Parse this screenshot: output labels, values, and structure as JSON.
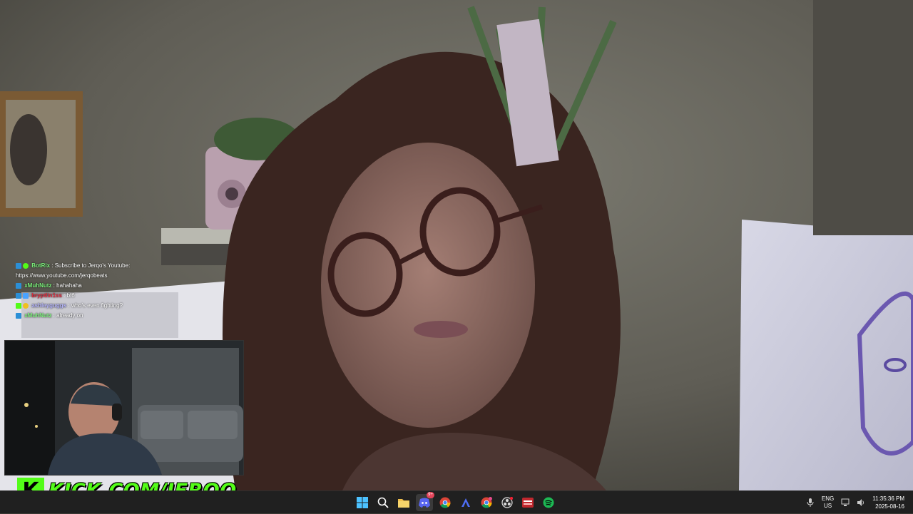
{
  "chat": {
    "messages": [
      {
        "user": "BotRix",
        "text": "Subscribe to Jerqo's Youtube:",
        "cont": "https://www.youtube.com/jerqobeats",
        "color": "#7cf27c"
      },
      {
        "user": "xMuhNutz",
        "text": "hahahaha",
        "color": "#7cf27c"
      },
      {
        "user": "bryptlin1ss",
        "text": "bf6",
        "color": "#e0283a"
      },
      {
        "user": "ashleyguggs",
        "text": "who's even fighting?",
        "color": "#b6b6ff"
      },
      {
        "user": "xMuhNutz",
        "text": "already on",
        "color": "#7cf27c"
      }
    ],
    "separator": " : "
  },
  "overlay": {
    "kick_logo": "K",
    "kick_url": "KICK.COM/JERQO"
  },
  "taskbar": {
    "icons": [
      "windows-start-icon",
      "search-icon",
      "file-explorer-icon",
      "discord-icon",
      "chrome-icon",
      "arc-browser-icon",
      "chrome-alt-icon",
      "obs-icon",
      "video-app-icon",
      "spotify-icon"
    ],
    "discord_badge": "9+",
    "lang_line1": "ENG",
    "lang_line2": "US",
    "time": "11:35:36 PM",
    "date": "2025-08-16"
  },
  "colors": {
    "kick_green": "#53fc18",
    "taskbar_bg": "#202020"
  }
}
